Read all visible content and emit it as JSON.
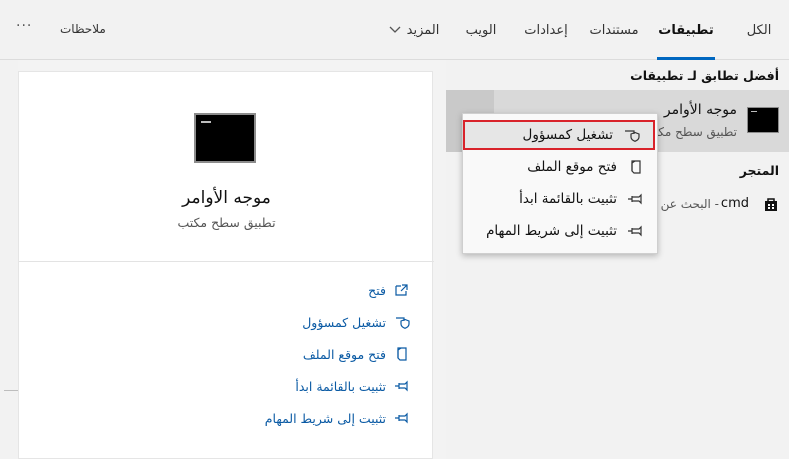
{
  "tabs": [
    {
      "label": "الكل"
    },
    {
      "label": "تطبيقات"
    },
    {
      "label": "مستندات"
    },
    {
      "label": "إعدادات"
    },
    {
      "label": "الويب"
    },
    {
      "label": "المزيد"
    }
  ],
  "header": {
    "feedback_label": "ملاحظات",
    "more_options": "···"
  },
  "results": {
    "best_match_heading": "أفضل تطابق لـ تطبيقات",
    "best_match": {
      "title": "موجه الأوامر",
      "subtitle": "تطبيق سطح مكتب"
    },
    "store_heading": "المتجر",
    "store_item": {
      "term": "cmd",
      "subtitle": "- البحث عن"
    }
  },
  "preview": {
    "title": "موجه الأوامر",
    "subtitle": "تطبيق سطح مكتب",
    "actions": [
      {
        "label": "فتح",
        "icon": "open-icon"
      },
      {
        "label": "تشغيل كمسؤول",
        "icon": "shield-icon"
      },
      {
        "label": "فتح موقع الملف",
        "icon": "file-location-icon"
      },
      {
        "label": "تثبيت بالقائمة ابدأ",
        "icon": "pin-icon"
      },
      {
        "label": "تثبيت إلى شريط المهام",
        "icon": "pin-icon"
      }
    ]
  },
  "context_menu": {
    "items": [
      {
        "label": "تشغيل كمسؤول",
        "icon": "shield-icon"
      },
      {
        "label": "فتح موقع الملف",
        "icon": "file-location-icon"
      },
      {
        "label": "تثبيت بالقائمة ابدأ",
        "icon": "pin-icon"
      },
      {
        "label": "تثبيت إلى شريط المهام",
        "icon": "pin-icon"
      }
    ]
  },
  "colors": {
    "accent": "#0067c0",
    "highlight_border": "#d9232b",
    "link": "#0a5aa4"
  }
}
